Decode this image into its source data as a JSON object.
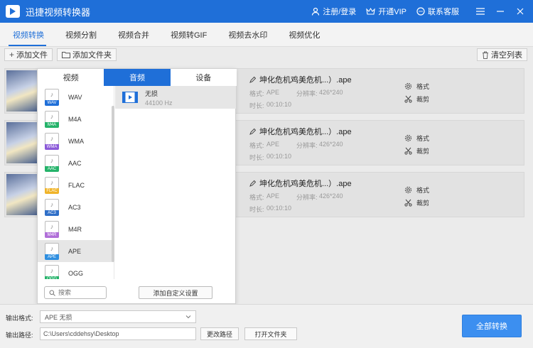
{
  "titlebar": {
    "title": "迅捷视频转换器",
    "login": "注册/登录",
    "vip": "开通VIP",
    "support": "联系客服"
  },
  "tabs": [
    {
      "label": "视频转换",
      "active": true
    },
    {
      "label": "视频分割"
    },
    {
      "label": "视频合并"
    },
    {
      "label": "视频转GIF"
    },
    {
      "label": "视频去水印"
    },
    {
      "label": "视频优化"
    }
  ],
  "toolbar": {
    "add_file": "添加文件",
    "add_folder": "添加文件夹",
    "clear_list": "清空列表"
  },
  "files": [
    {
      "name": "坤化危机鸡美危机...）.ape",
      "format_label": "格式:",
      "format": "APE",
      "res_label": "分辨率:",
      "res": "426*240",
      "dur_label": "时长:",
      "duration": "00:10:10",
      "action_format": "格式",
      "action_cut": "裁剪"
    },
    {
      "name": "坤化危机鸡美危机...）.ape",
      "format_label": "格式:",
      "format": "APE",
      "res_label": "分辨率:",
      "res": "426*240",
      "dur_label": "时长:",
      "duration": "00:10:10",
      "action_format": "格式",
      "action_cut": "裁剪"
    },
    {
      "name": "坤化危机鸡美危机...）.ape",
      "format_label": "格式:",
      "format": "APE",
      "res_label": "分辨率:",
      "res": "426*240",
      "dur_label": "时长:",
      "duration": "00:10:10",
      "action_format": "格式",
      "action_cut": "裁剪"
    }
  ],
  "panel": {
    "tabs": [
      {
        "label": "视频"
      },
      {
        "label": "音频",
        "active": true
      },
      {
        "label": "设备"
      }
    ],
    "formats": [
      {
        "name": "WAV",
        "color": "#1f6fd8"
      },
      {
        "name": "M4A",
        "color": "#25b36a"
      },
      {
        "name": "WMA",
        "color": "#8b5ad8"
      },
      {
        "name": "AAC",
        "color": "#25b36a"
      },
      {
        "name": "FLAC",
        "color": "#f0b429"
      },
      {
        "name": "AC3",
        "color": "#2f6fc8"
      },
      {
        "name": "M4R",
        "color": "#b06fd8"
      },
      {
        "name": "APE",
        "color": "#2f8fe0",
        "active": true
      },
      {
        "name": "OGG",
        "color": "#25b36a"
      }
    ],
    "preset": {
      "title": "无损",
      "subtitle": "44100 Hz"
    },
    "search_placeholder": "搜索",
    "custom_button": "添加自定义设置"
  },
  "bottom": {
    "format_label": "输出格式:",
    "format_value": "APE  无损",
    "path_label": "输出路径:",
    "path_value": "C:\\Users\\cddehsy\\Desktop",
    "change_path": "更改路径",
    "open_folder": "打开文件夹",
    "convert_all": "全部转换"
  },
  "colors": {
    "brand": "#1f6fd8",
    "convert": "#3c8ff0"
  }
}
